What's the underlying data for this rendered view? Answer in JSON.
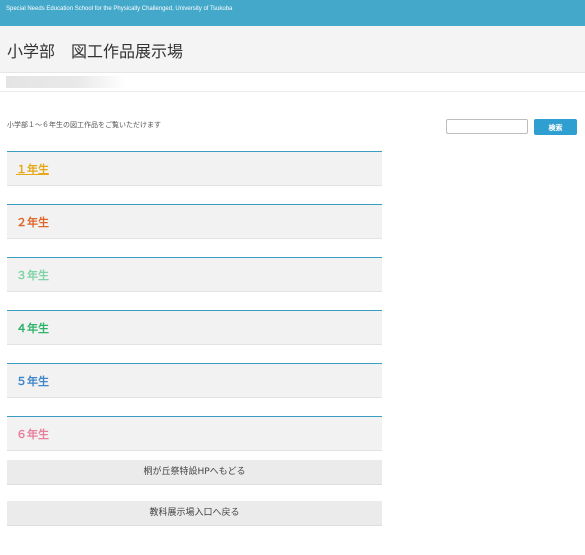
{
  "header": {
    "school_name": "Special Needs Education School for the Physically Challenged, University of Tsukuba",
    "bar_color": "#43a8c9"
  },
  "page": {
    "title": "小学部　図工作品展示場",
    "intro": "小学部１～６年生の図工作品をご覧いただけます"
  },
  "search": {
    "value": "",
    "button_label": "検索",
    "button_color": "#2f9ed0"
  },
  "grades": [
    {
      "label": "１年生",
      "color": "#e6a817",
      "active": true
    },
    {
      "label": "２年生",
      "color": "#e0662a",
      "active": false
    },
    {
      "label": "３年生",
      "color": "#7fd3a6",
      "active": false
    },
    {
      "label": "４年生",
      "color": "#2fb36b",
      "active": false
    },
    {
      "label": "５年生",
      "color": "#3e86c9",
      "active": false
    },
    {
      "label": "６年生",
      "color": "#e87f9d",
      "active": false
    }
  ],
  "actions": {
    "back_home": "桐が丘祭特設HPへもどる",
    "back_entrance": "教科展示場入口へ戻る"
  }
}
